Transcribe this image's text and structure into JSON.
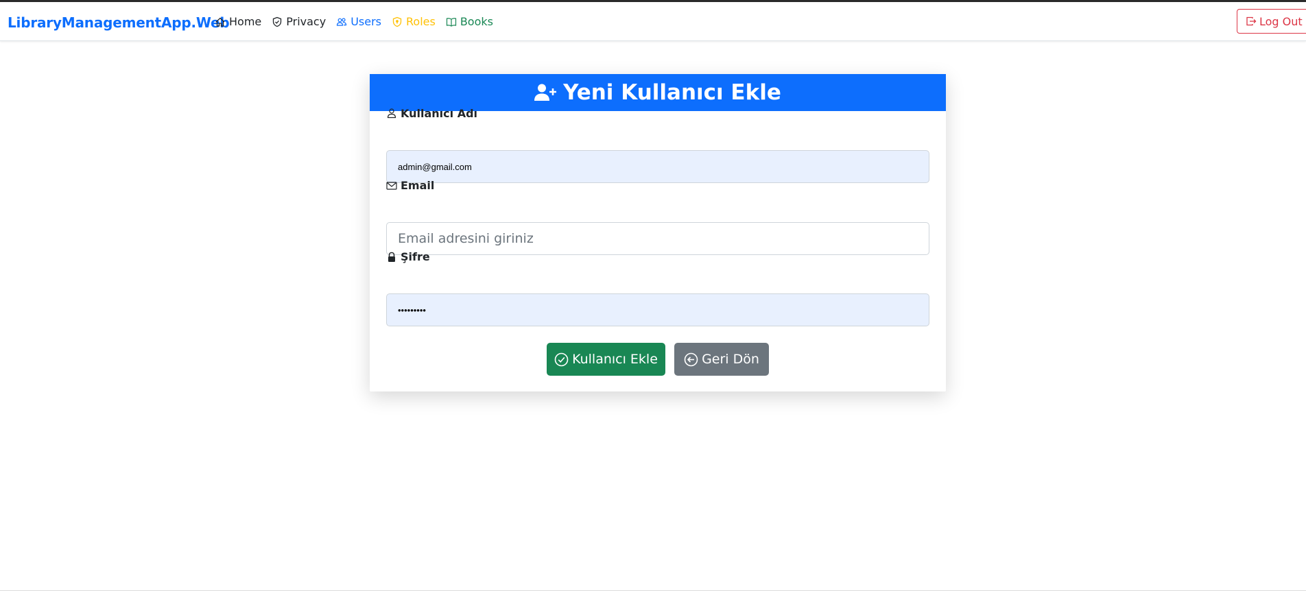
{
  "app": {
    "brand": "LibraryManagementApp.Web"
  },
  "nav": {
    "items": [
      {
        "label": "Home",
        "icon": "house-icon",
        "color": "#212529"
      },
      {
        "label": "Privacy",
        "icon": "shield-icon",
        "color": "#212529"
      },
      {
        "label": "Users",
        "icon": "people-icon",
        "color": "#0d6efd"
      },
      {
        "label": "Roles",
        "icon": "shield-lock-icon",
        "color": "#ffc107"
      },
      {
        "label": "Books",
        "icon": "book-icon",
        "color": "#198754"
      }
    ],
    "logout_label": "Log Out"
  },
  "form": {
    "title": "Yeni Kullanıcı Ekle",
    "username": {
      "label": "Kullanıcı Adı",
      "value": "admin@gmail.com",
      "icon": "person-icon"
    },
    "email": {
      "label": "Email",
      "value": "",
      "placeholder": "Email adresini giriniz",
      "icon": "envelope-icon"
    },
    "password": {
      "label": "Şifre",
      "value": "•••••••••",
      "icon": "lock-icon"
    },
    "submit_label": "Kullanıcı Ekle",
    "back_label": "Geri Dön"
  },
  "colors": {
    "primary": "#0d6efd",
    "success": "#198754",
    "secondary": "#6c757d",
    "danger": "#dc3545",
    "warning": "#ffc107",
    "autofill": "#e8f0fe"
  }
}
